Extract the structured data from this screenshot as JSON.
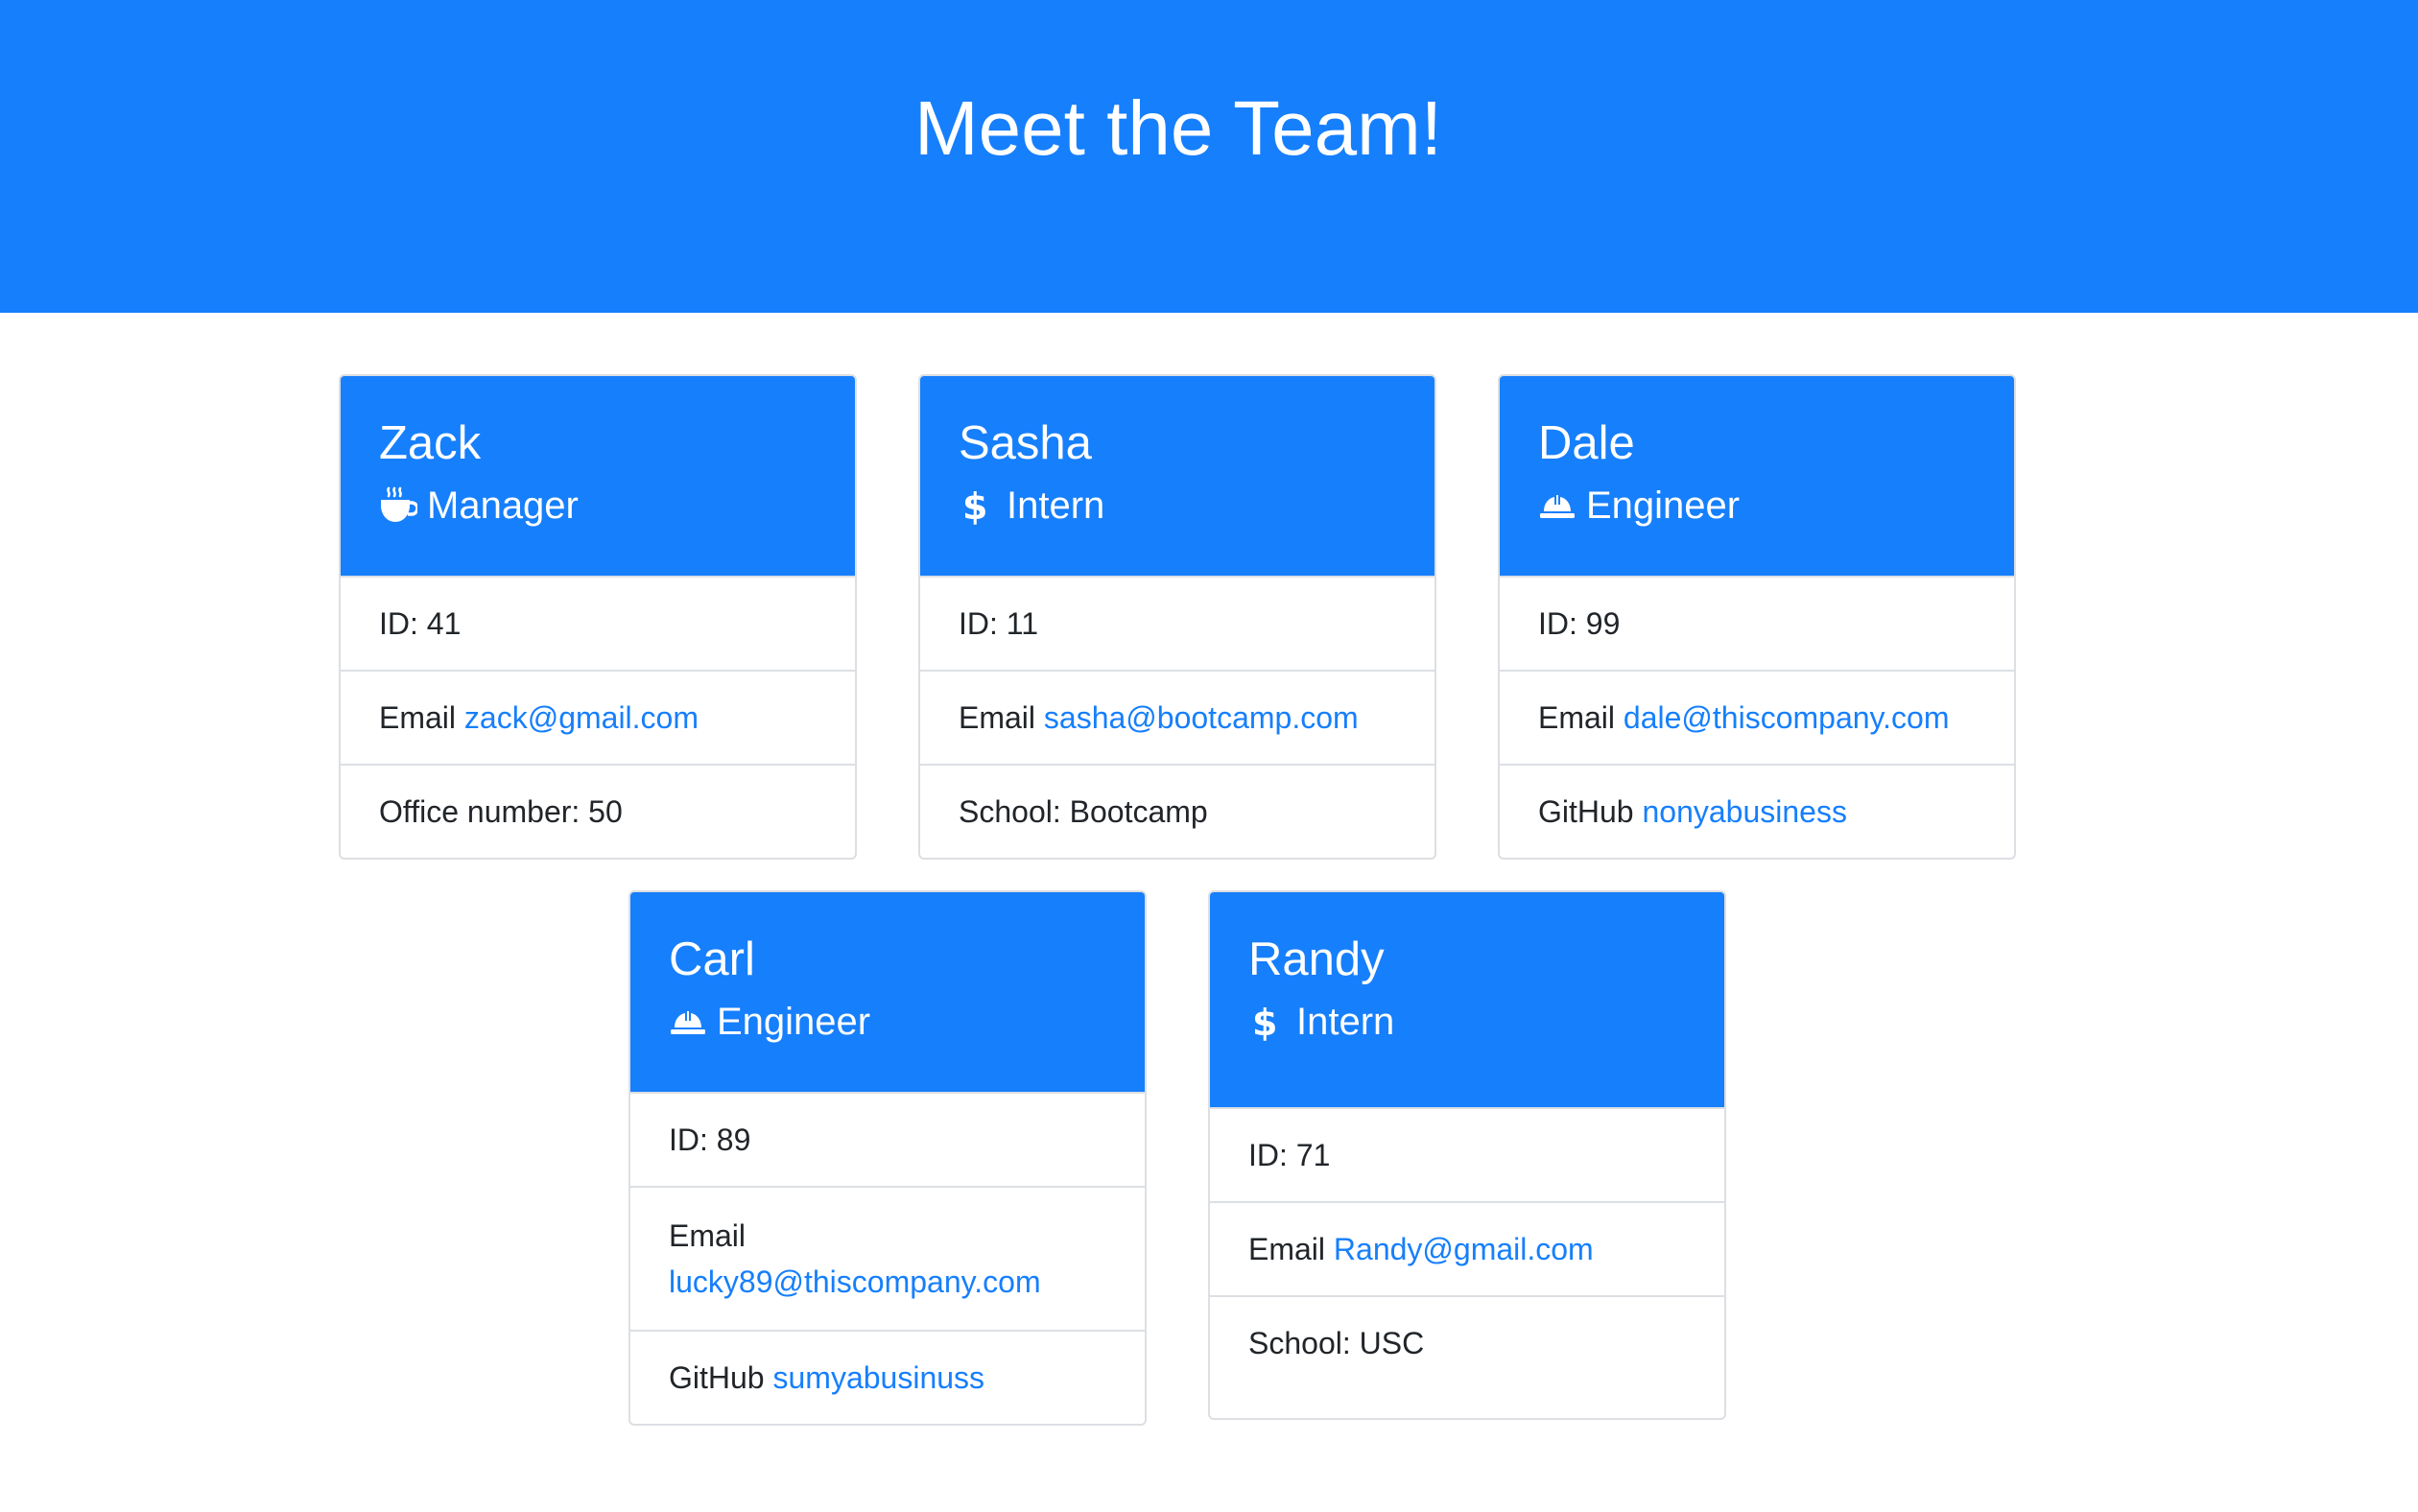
{
  "page": {
    "title": "Meet the Team!"
  },
  "colors": {
    "primary": "#167ffc",
    "border": "#dcdfe3"
  },
  "team": [
    {
      "name": "Zack",
      "role": "Manager",
      "icon": "coffee-mug-icon",
      "id_text": "ID: 41",
      "email_label": "Email",
      "email": "zack@gmail.com",
      "extra_label": "Office number: 50",
      "extra_link": ""
    },
    {
      "name": "Sasha",
      "role": "Intern",
      "icon": "dollar-icon",
      "id_text": "ID: 11",
      "email_label": "Email",
      "email": "sasha@bootcamp.com",
      "extra_label": "School: Bootcamp",
      "extra_link": ""
    },
    {
      "name": "Dale",
      "role": "Engineer",
      "icon": "hard-hat-icon",
      "id_text": "ID: 99",
      "email_label": "Email",
      "email": "dale@thiscompany.com",
      "extra_label": "GitHub",
      "extra_link": "nonyabusiness"
    },
    {
      "name": "Carl",
      "role": "Engineer",
      "icon": "hard-hat-icon",
      "id_text": "ID: 89",
      "email_label": "Email",
      "email": "lucky89@thiscompany.com",
      "extra_label": "GitHub",
      "extra_link": "sumyabusinuss"
    },
    {
      "name": "Randy",
      "role": "Intern",
      "icon": "dollar-icon",
      "id_text": "ID: 71",
      "email_label": "Email",
      "email": "Randy@gmail.com",
      "extra_label": "School: USC",
      "extra_link": ""
    }
  ]
}
